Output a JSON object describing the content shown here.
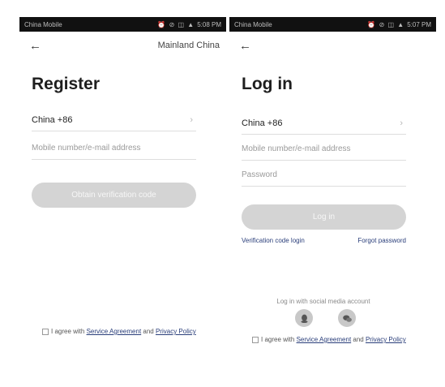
{
  "left": {
    "status": {
      "carrier": "China Mobile ",
      "icons": "⏰ ⊘ ◫ ▲",
      "time": "5:08 PM"
    },
    "region": "Mainland China",
    "title": "Register",
    "country": "China +86",
    "account_placeholder": "Mobile number/e-mail address",
    "obtain_label": "Obtain verification code",
    "agree": {
      "prefix": "I agree with ",
      "service": "Service Agreement",
      "and": " and ",
      "privacy": "Privacy Policy"
    }
  },
  "right": {
    "status": {
      "carrier": "China Mobile ",
      "icons": "⏰ ⊘ ◫ ▲",
      "time": "5:07 PM"
    },
    "title": "Log in",
    "country": "China +86",
    "account_placeholder": "Mobile number/e-mail address",
    "password_placeholder": "Password",
    "login_label": "Log in",
    "verification_login": "Verification code login",
    "forgot_password": "Forgot password",
    "social_label": "Log in with social media account",
    "agree": {
      "prefix": "I agree with ",
      "service": "Service Agreement",
      "and": " and ",
      "privacy": "Privacy Policy"
    }
  },
  "chevron": "›",
  "back_arrow": "←",
  "icons": [
    "back-arrow-icon",
    "chevron-right-icon",
    "checkbox-icon",
    "qq-icon",
    "wechat-icon"
  ],
  "colors": {
    "button_disabled": "#d4d4d4",
    "link": "#2a3e7a",
    "divider": "#dddddd"
  }
}
